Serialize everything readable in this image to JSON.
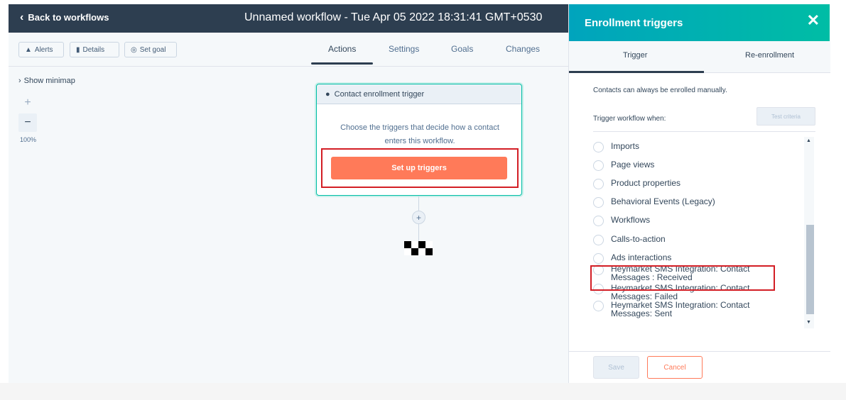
{
  "topbar": {
    "back_label": "Back to workflows",
    "title": "Unnamed workflow - Tue Apr 05 2022 18:31:41 GMT+0530"
  },
  "toolbar": {
    "alerts_label": "Alerts",
    "details_label": "Details",
    "set_goal_label": "Set goal"
  },
  "tabs": [
    "Actions",
    "Settings",
    "Goals",
    "Changes"
  ],
  "canvas": {
    "minimap_label": "Show minimap",
    "zoom_in": "+",
    "zoom_out": "−",
    "zoom_level": "100%",
    "trigger_card": {
      "title": "Contact enrollment trigger",
      "description": "Choose the triggers that decide how a contact enters this workflow.",
      "button_label": "Set up triggers"
    },
    "add_action": "+"
  },
  "panel": {
    "title": "Enrollment triggers",
    "close": "✕",
    "tabs": [
      "Trigger",
      "Re-enrollment"
    ],
    "manual_note": "Contacts can always be enrolled manually.",
    "when_label": "Trigger workflow when:",
    "test_criteria": "Test criteria",
    "items": [
      "Imports",
      "Page views",
      "Product properties",
      "Behavioral Events (Legacy)",
      "Workflows",
      "Calls-to-action",
      "Ads interactions",
      "Heymarket SMS Integration: Contact Messages : Received",
      "Heymarket SMS Integration: Contact Messages: Failed",
      "Heymarket SMS Integration: Contact Messages: Sent"
    ],
    "save_label": "Save",
    "cancel_label": "Cancel"
  },
  "colors": {
    "header_dark": "#2d3e50",
    "accent_teal": "#00bda5",
    "button_orange": "#ff7a59",
    "highlight_red": "#d31e25"
  }
}
